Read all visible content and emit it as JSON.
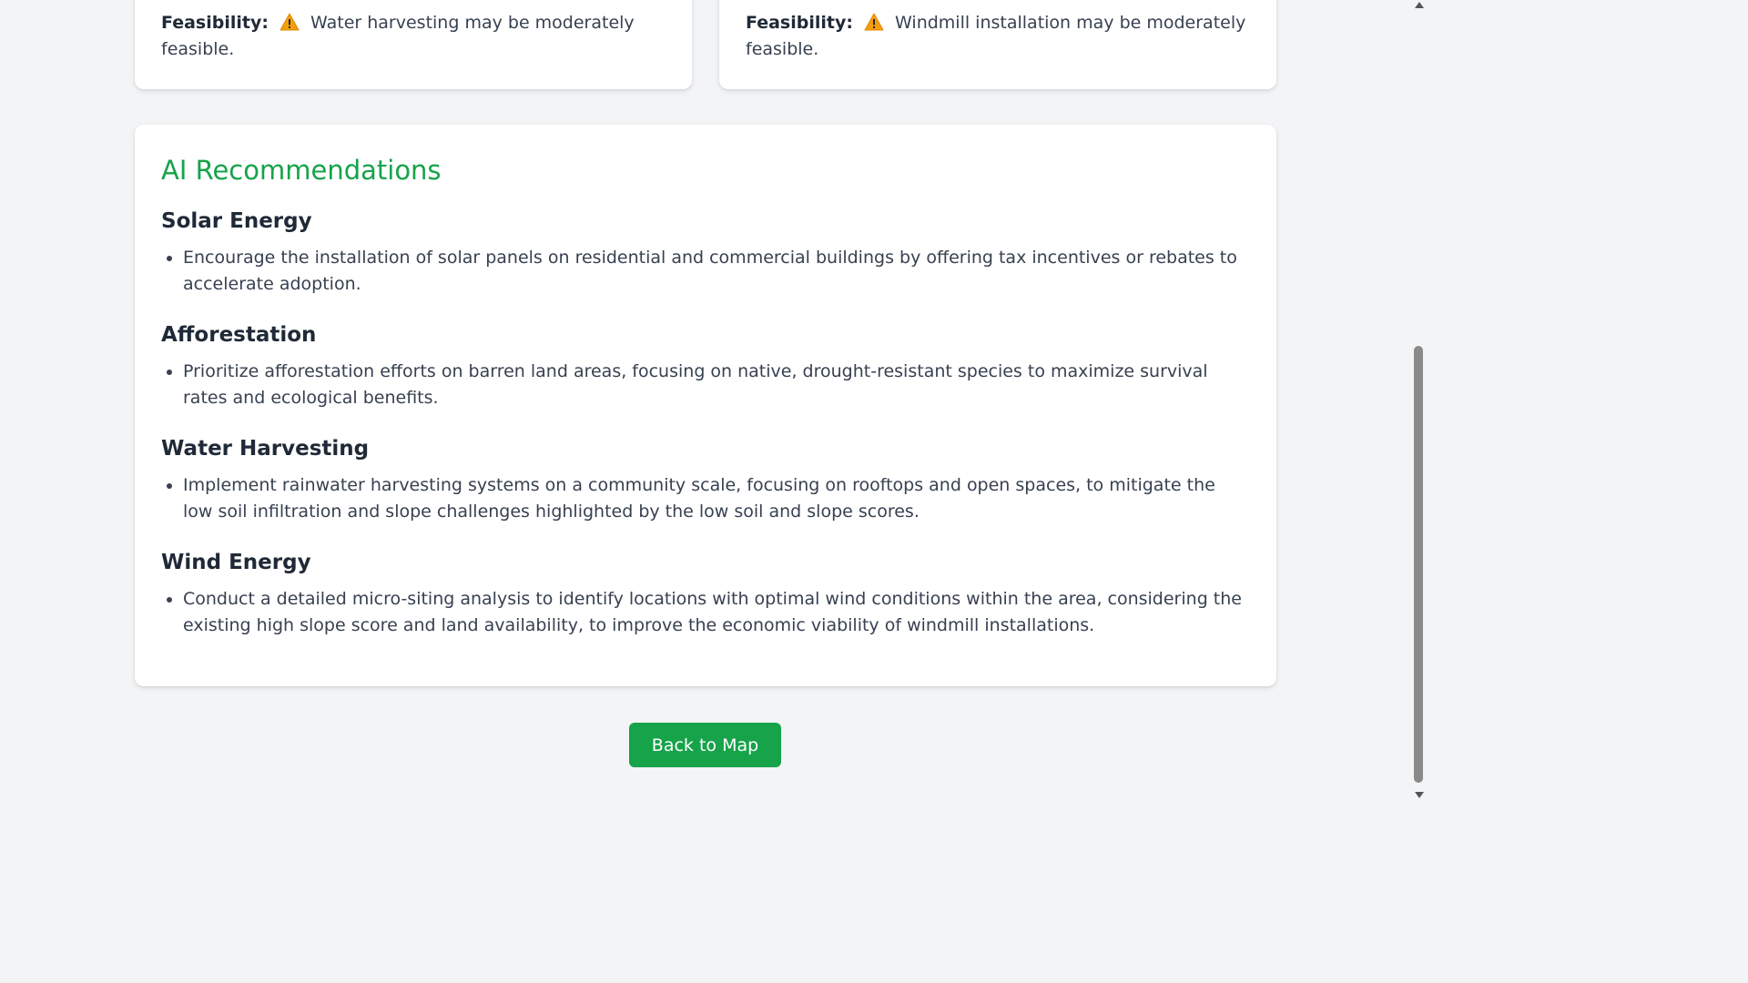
{
  "feasibility_cards": [
    {
      "label": "Feasibility:",
      "icon": "warning-icon",
      "text": "Water harvesting may be moderately feasible."
    },
    {
      "label": "Feasibility:",
      "icon": "warning-icon",
      "text": "Windmill installation may be moderately feasible."
    }
  ],
  "recommendations": {
    "title": "AI Recommendations",
    "sections": [
      {
        "heading": "Solar Energy",
        "items": [
          "Encourage the installation of solar panels on residential and commercial buildings by offering tax incentives or rebates to accelerate adoption."
        ]
      },
      {
        "heading": "Afforestation",
        "items": [
          "Prioritize afforestation efforts on barren land areas, focusing on native, drought-resistant species to maximize survival rates and ecological benefits."
        ]
      },
      {
        "heading": "Water Harvesting",
        "items": [
          "Implement rainwater harvesting systems on a community scale, focusing on rooftops and open spaces, to mitigate the low soil infiltration and slope challenges highlighted by the low soil and slope scores."
        ]
      },
      {
        "heading": "Wind Energy",
        "items": [
          "Conduct a detailed micro-siting analysis to identify locations with optimal wind conditions within the area, considering the existing high slope score and land availability, to improve the economic viability of windmill installations."
        ]
      }
    ]
  },
  "actions": {
    "back_label": "Back to Map"
  },
  "colors": {
    "accent": "#16a34a",
    "warning": "#f59e0b",
    "background": "#f3f4f6"
  }
}
